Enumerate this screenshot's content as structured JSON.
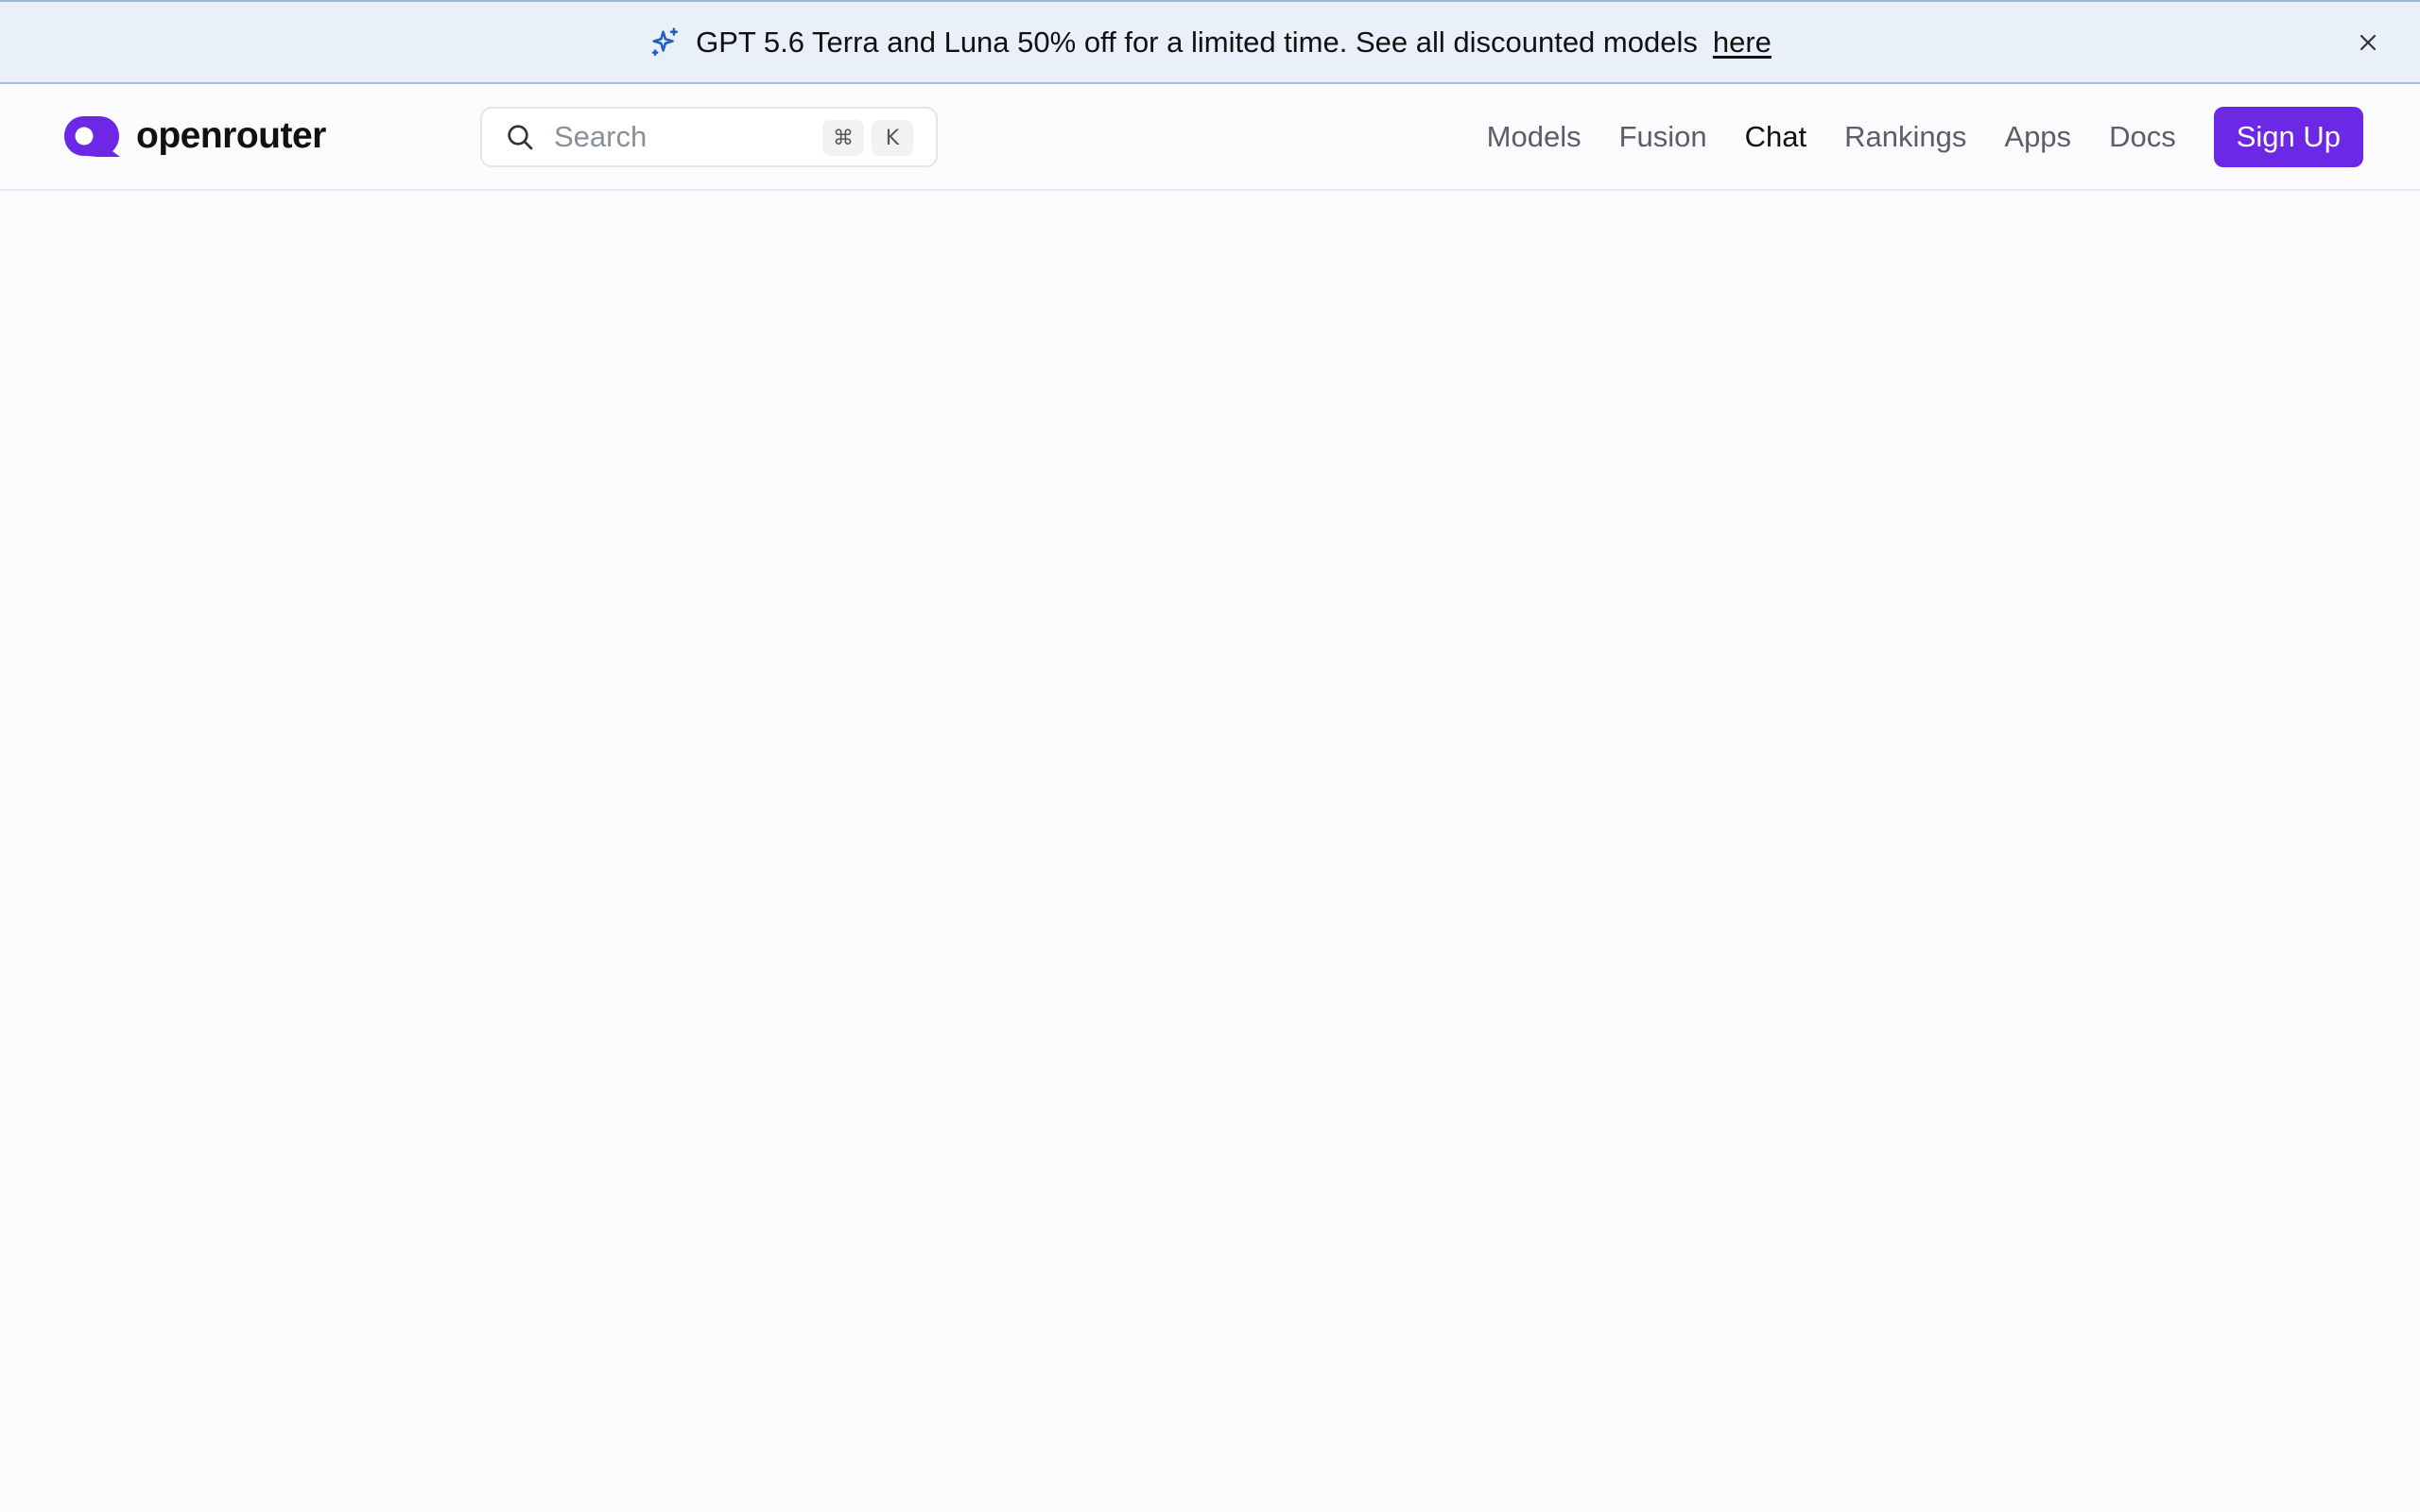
{
  "banner": {
    "message": "GPT 5.6 Terra and Luna 50% off for a limited time. See all discounted models",
    "link_text": "here",
    "icon": "sparkle-icon",
    "close_icon": "close-icon",
    "accent": "#1f5fbf"
  },
  "header": {
    "logo_text": "openrouter",
    "brand_color": "#6d28e6",
    "search": {
      "placeholder": "Search",
      "value": "",
      "shortcut_keys": [
        "⌘",
        "K"
      ]
    },
    "nav": [
      {
        "label": "Models",
        "active": false
      },
      {
        "label": "Fusion",
        "active": false
      },
      {
        "label": "Chat",
        "active": true
      },
      {
        "label": "Rankings",
        "active": false
      },
      {
        "label": "Apps",
        "active": false
      },
      {
        "label": "Docs",
        "active": false
      }
    ],
    "signup_label": "Sign Up"
  }
}
